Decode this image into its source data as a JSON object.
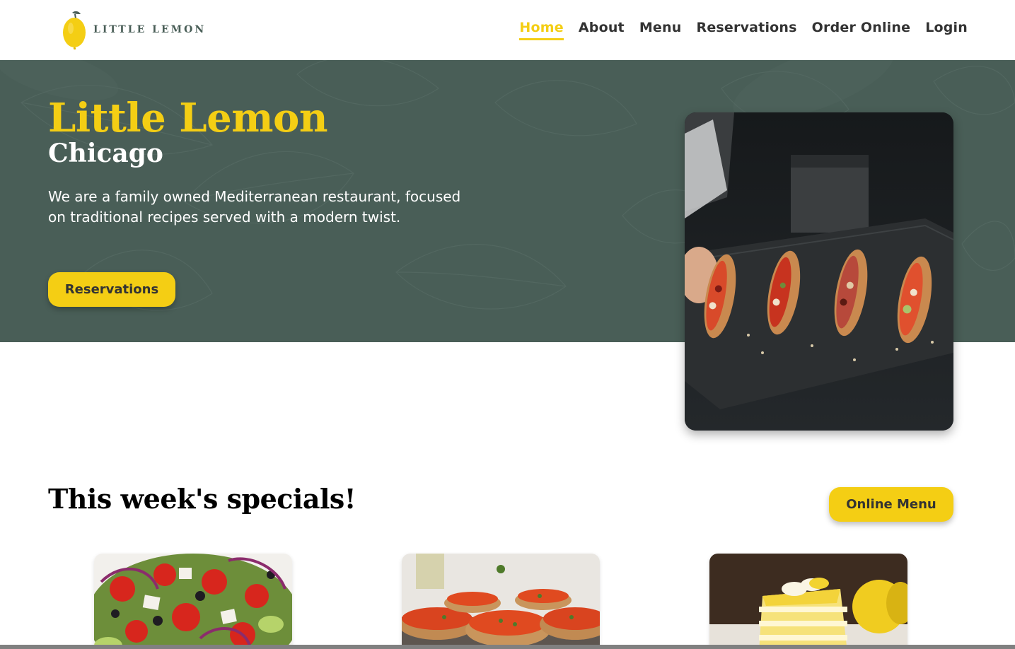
{
  "brand": {
    "logo_text": "LITTLE LEMON",
    "colors": {
      "primary_green": "#495E57",
      "primary_yellow": "#F4CE14",
      "text_dark": "#333333"
    }
  },
  "nav": {
    "items": [
      {
        "label": "Home",
        "active": true
      },
      {
        "label": "About"
      },
      {
        "label": "Menu"
      },
      {
        "label": "Reservations"
      },
      {
        "label": "Order Online"
      },
      {
        "label": "Login"
      }
    ]
  },
  "hero": {
    "title": "Little Lemon",
    "subtitle": "Chicago",
    "description": "We are a family owned Mediterranean restaurant, focused on traditional recipes served with a modern twist.",
    "cta_label": "Reservations"
  },
  "specials": {
    "title": "This week's specials!",
    "menu_button_label": "Online Menu"
  }
}
